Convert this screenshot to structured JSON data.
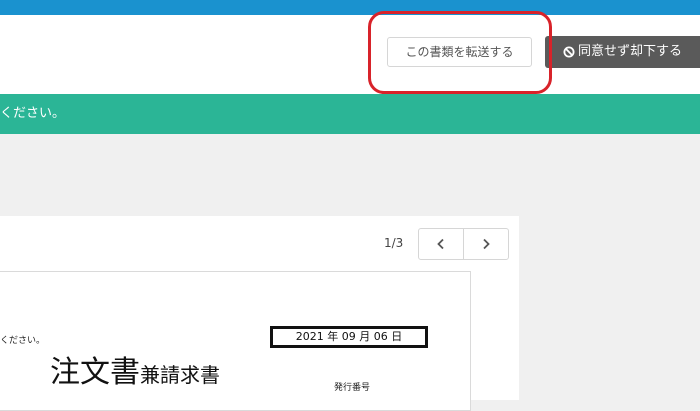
{
  "header": {
    "forward_button": "この書類を転送する",
    "reject_button": "同意せず却下する",
    "reject_icon": "ban-icon"
  },
  "banner": {
    "message": "ください。"
  },
  "pager": {
    "count": "1/3",
    "prev_icon": "chevron-left-icon",
    "next_icon": "chevron-right-icon"
  },
  "document": {
    "note": "ください。",
    "title_main": "注文書",
    "title_sub": "兼請求書",
    "date": "2021 年 09 月 06 日",
    "issue_label": "発行番号"
  },
  "colors": {
    "topbar": "#1a92cf",
    "banner": "#2bb596",
    "reject": "#5a5a5a",
    "highlight": "#d8232a"
  }
}
